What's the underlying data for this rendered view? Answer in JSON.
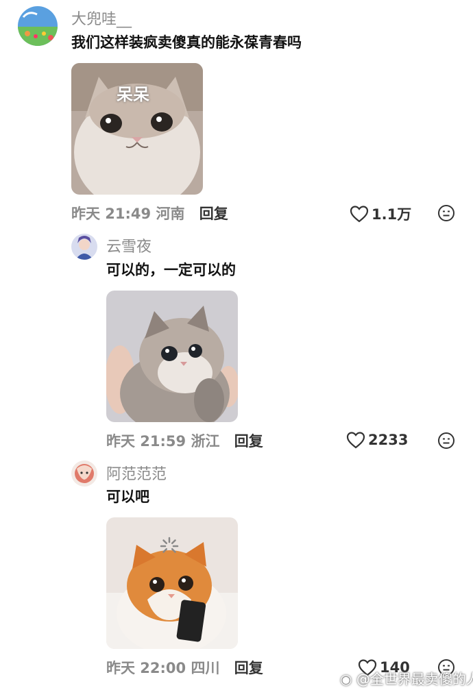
{
  "comments": [
    {
      "username": "大兜哇__",
      "text": "我们这样装疯卖傻真的能永葆青春吗",
      "image_caption": "呆呆",
      "time": "昨天 21:49",
      "location": "河南",
      "reply_label": "回复",
      "likes": "1.1万"
    },
    {
      "username": "云雪夜",
      "text": "可以的，一定可以的",
      "time": "昨天 21:59",
      "location": "浙江",
      "reply_label": "回复",
      "likes": "2233"
    },
    {
      "username": "阿范范范",
      "text": "可以吧",
      "time": "昨天 22:00",
      "location": "四川",
      "reply_label": "回复",
      "likes": "140"
    }
  ],
  "watermark": "@全世界最卖傻的人",
  "icons": {
    "like": "heart-outline-icon",
    "react": "emoji-face-icon"
  },
  "colors": {
    "username": "#8a8a8a",
    "text": "#111111",
    "meta": "#8a8a8a"
  }
}
